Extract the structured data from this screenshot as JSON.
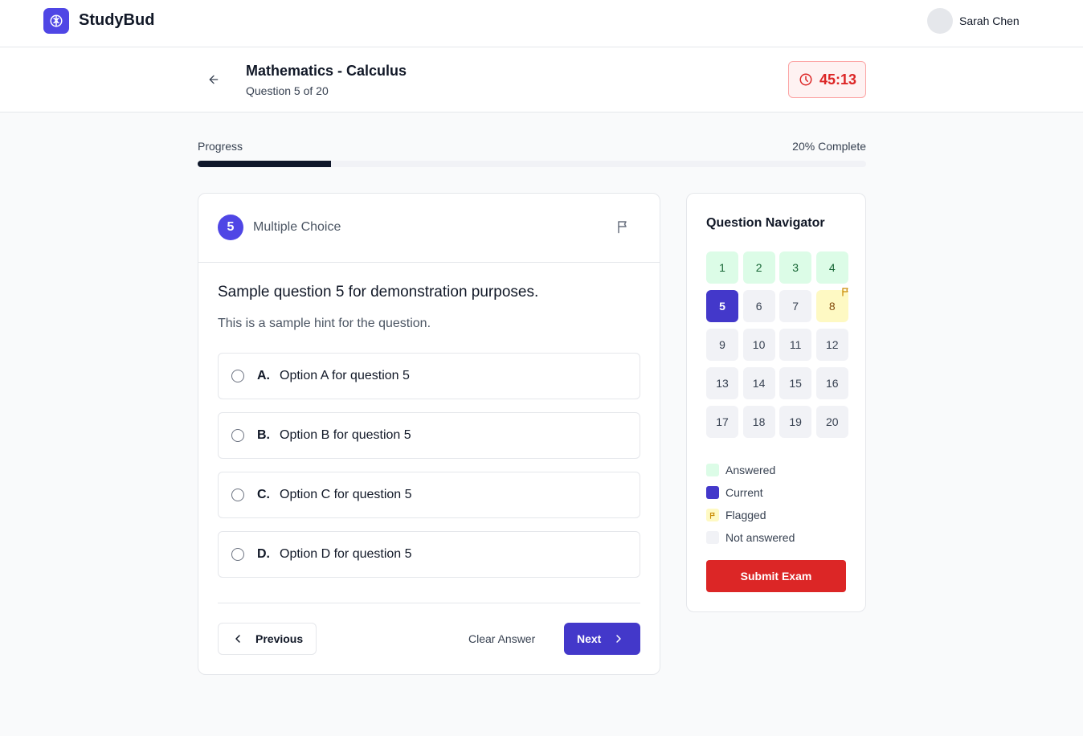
{
  "app": {
    "name": "StudyBud",
    "user_name": "Sarah Chen"
  },
  "exam": {
    "title": "Mathematics - Calculus",
    "question_count_text": "Question 5 of 20",
    "timer": "45:13"
  },
  "progress": {
    "label": "Progress",
    "percent_text": "20% Complete",
    "value": 0.2
  },
  "question": {
    "number": "5",
    "type": "Multiple Choice",
    "text": "Sample question 5 for demonstration purposes.",
    "hint": "This is a sample hint for the question.",
    "options": [
      {
        "letter": "A.",
        "text": "Option A for question 5"
      },
      {
        "letter": "B.",
        "text": "Option B for question 5"
      },
      {
        "letter": "C.",
        "text": "Option C for question 5"
      },
      {
        "letter": "D.",
        "text": "Option D for question 5"
      }
    ]
  },
  "actions": {
    "previous": "Previous",
    "clear": "Clear Answer",
    "next": "Next"
  },
  "navigator": {
    "title": "Question Navigator",
    "cells": [
      {
        "num": "1",
        "status": "answered"
      },
      {
        "num": "2",
        "status": "answered"
      },
      {
        "num": "3",
        "status": "answered"
      },
      {
        "num": "4",
        "status": "answered"
      },
      {
        "num": "5",
        "status": "current"
      },
      {
        "num": "6",
        "status": "not-answered"
      },
      {
        "num": "7",
        "status": "not-answered"
      },
      {
        "num": "8",
        "status": "flagged"
      },
      {
        "num": "9",
        "status": "not-answered"
      },
      {
        "num": "10",
        "status": "not-answered"
      },
      {
        "num": "11",
        "status": "not-answered"
      },
      {
        "num": "12",
        "status": "not-answered"
      },
      {
        "num": "13",
        "status": "not-answered"
      },
      {
        "num": "14",
        "status": "not-answered"
      },
      {
        "num": "15",
        "status": "not-answered"
      },
      {
        "num": "16",
        "status": "not-answered"
      },
      {
        "num": "17",
        "status": "not-answered"
      },
      {
        "num": "18",
        "status": "not-answered"
      },
      {
        "num": "19",
        "status": "not-answered"
      },
      {
        "num": "20",
        "status": "not-answered"
      }
    ],
    "legend": {
      "answered": "Answered",
      "current": "Current",
      "flagged": "Flagged",
      "not_answered": "Not answered"
    },
    "submit": "Submit Exam"
  },
  "colors": {
    "accent": "#4338ca",
    "danger": "#dc2626",
    "answered": "#dcfce7",
    "flagged": "#fef9c3",
    "unanswered": "#f1f2f6"
  },
  "icons": {
    "logo": "brain-icon",
    "back": "arrow-left-icon",
    "timer": "clock-icon",
    "flag": "flag-icon",
    "prev": "chevron-left-icon",
    "next": "chevron-right-icon"
  }
}
